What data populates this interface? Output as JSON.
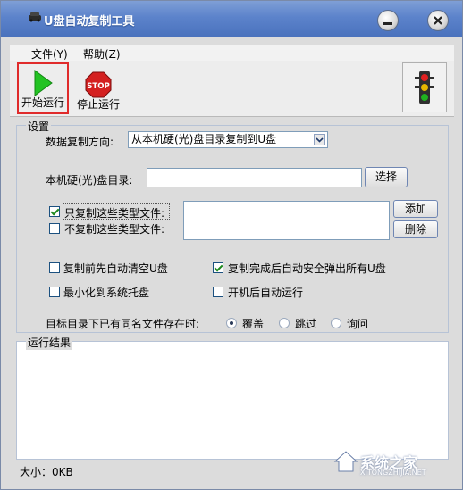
{
  "window": {
    "title": "U盘自动复制工具"
  },
  "menu": {
    "file": "文件(Y)",
    "help": "帮助(Z)"
  },
  "toolbar": {
    "run_label": "开始运行",
    "stop_label": "停止运行",
    "stop_sign_text": "STOP"
  },
  "settings": {
    "group_label": "设置",
    "direction_label": "数据复制方向:",
    "direction_value": "从本机硬(光)盘目录复制到U盘",
    "dir_label": "本机硬(光)盘目录:",
    "dir_value": "",
    "choose_button": "选择",
    "only_copy_label": "只复制这些类型文件:",
    "only_copy_checked": true,
    "not_copy_label": "不复制这些类型文件:",
    "not_copy_checked": false,
    "add_button": "添加",
    "delete_button": "删除",
    "clear_before_label": "复制前先自动清空U盘",
    "clear_before_checked": false,
    "eject_after_label": "复制完成后自动安全弹出所有U盘",
    "eject_after_checked": true,
    "minimize_tray_label": "最小化到系统托盘",
    "minimize_tray_checked": false,
    "autorun_label": "开机后自动运行",
    "autorun_checked": false,
    "conflict_label": "目标目录下已有同名文件存在时:",
    "conflict_options": [
      "覆盖",
      "跳过",
      "询问"
    ],
    "conflict_selected": "覆盖"
  },
  "results": {
    "group_label": "运行结果"
  },
  "status": {
    "size": "大小：0KB"
  },
  "watermark": {
    "text": "系统之家",
    "sub": "XITONGZHIJIA.NET"
  },
  "colors": {
    "accent": "#5c83cb",
    "run_green": "#22c322",
    "stop_red": "#d42020",
    "highlight_border": "#e02b2b"
  }
}
